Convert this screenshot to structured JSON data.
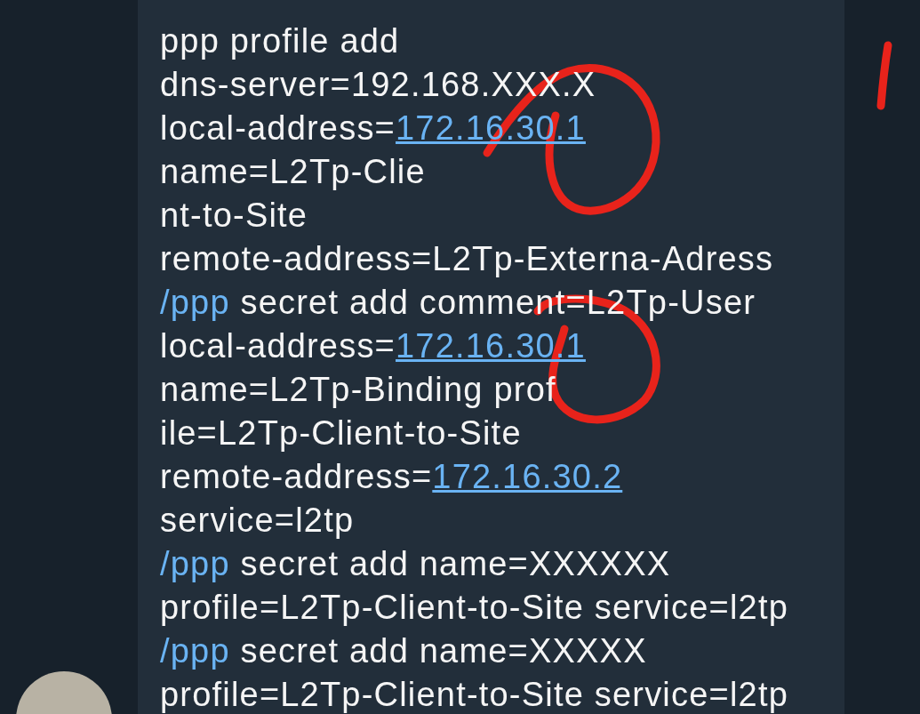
{
  "message": {
    "lines": [
      {
        "segments": [
          {
            "kind": "text",
            "text": "ppp profile add"
          }
        ]
      },
      {
        "segments": [
          {
            "kind": "text",
            "text": "dns-server=192.168.XXX.X"
          }
        ]
      },
      {
        "segments": [
          {
            "kind": "text",
            "text": "local-address="
          },
          {
            "kind": "link",
            "text": "172.16.30.1"
          }
        ]
      },
      {
        "segments": [
          {
            "kind": "text",
            "text": "name=L2Tp-Clie"
          }
        ]
      },
      {
        "segments": [
          {
            "kind": "text",
            "text": "nt-to-Site"
          }
        ]
      },
      {
        "segments": [
          {
            "kind": "text",
            "text": "remote-address=L2Tp-Externa-Adress"
          }
        ]
      },
      {
        "segments": [
          {
            "kind": "command",
            "text": "/ppp"
          },
          {
            "kind": "text",
            "text": " secret add comment=L2Tp-User"
          }
        ]
      },
      {
        "segments": [
          {
            "kind": "text",
            "text": "local-address="
          },
          {
            "kind": "link",
            "text": "172.16.30.1"
          }
        ]
      },
      {
        "segments": [
          {
            "kind": "text",
            "text": "name=L2Tp-Binding prof"
          }
        ]
      },
      {
        "segments": [
          {
            "kind": "text",
            "text": "ile=L2Tp-Client-to-Site"
          }
        ]
      },
      {
        "segments": [
          {
            "kind": "text",
            "text": "remote-address="
          },
          {
            "kind": "link",
            "text": "172.16.30.2"
          }
        ]
      },
      {
        "segments": [
          {
            "kind": "text",
            "text": "service=l2tp"
          }
        ]
      },
      {
        "segments": [
          {
            "kind": "command",
            "text": "/ppp"
          },
          {
            "kind": "text",
            "text": " secret add name=XXXXXX"
          }
        ]
      },
      {
        "segments": [
          {
            "kind": "text",
            "text": "profile=L2Tp-Client-to-Site service=l2tp"
          }
        ]
      },
      {
        "segments": [
          {
            "kind": "command",
            "text": "/ppp"
          },
          {
            "kind": "text",
            "text": " secret add name=XXXXX"
          }
        ]
      },
      {
        "segments": [
          {
            "kind": "text",
            "text": "profile=L2Tp-Client-to-Site service=l2tp"
          }
        ]
      }
    ]
  }
}
